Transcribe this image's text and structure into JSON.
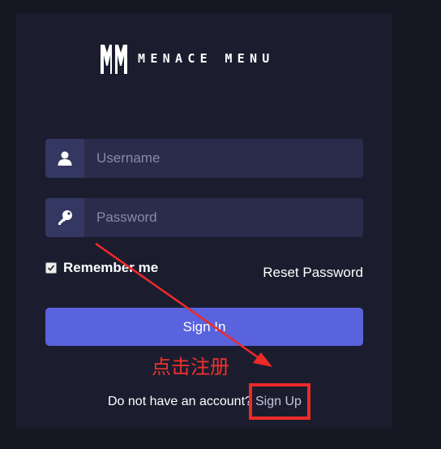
{
  "brand": {
    "logo_mark": "MM",
    "name": "MENACE MENU"
  },
  "form": {
    "username_placeholder": "Username",
    "password_placeholder": "Password",
    "remember_label": "Remember me",
    "remember_checked": true,
    "reset_label": "Reset Password",
    "signin_label": "Sign In"
  },
  "footer": {
    "no_account_text": "Do not have an account?",
    "signup_label": "Sign Up"
  },
  "annotation": {
    "text": "点击注册",
    "color": "#ee2a27"
  },
  "icons": {
    "username": "user-icon",
    "password": "key-icon"
  },
  "colors": {
    "background": "#151722",
    "card": "#1b1d2f",
    "input": "#2a2c4b",
    "input_icon": "#333761",
    "accent": "#5963de"
  }
}
